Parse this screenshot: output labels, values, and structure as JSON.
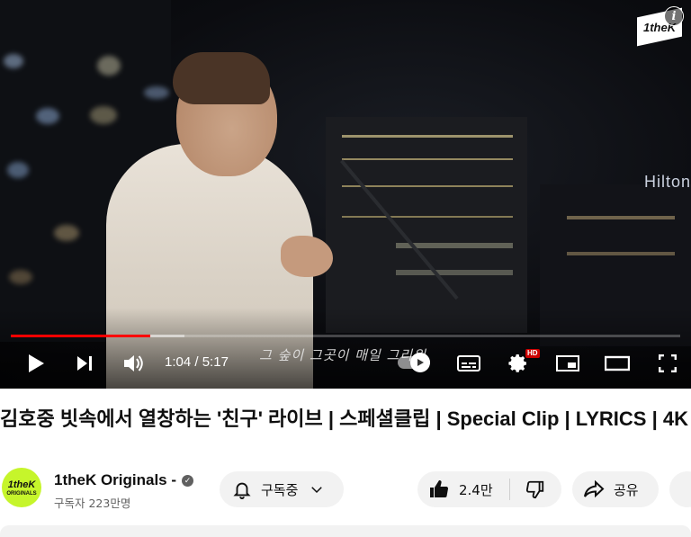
{
  "player": {
    "watermark": "1theK",
    "info_icon": "i",
    "building_sign": "Hilton",
    "subtitle": "그 숲이 그곳이 매일 그리워",
    "time_current": "1:04",
    "time_separator": "/",
    "time_total": "5:17",
    "progress_played_fraction": 0.208,
    "progress_buffered_fraction": 0.26,
    "hd_badge": "HD",
    "accent_color": "#ff0000"
  },
  "video": {
    "title": "김호중 빗속에서 열창하는 '친구' 라이브 | 스페셜클립 | Special Clip | LYRICS | 4K"
  },
  "channel": {
    "avatar_line1": "1theK",
    "avatar_line2": "ORIGINALS",
    "avatar_color": "#c6f52b",
    "name": "1theK Originals",
    "name_suffix": "-",
    "subscribers": "구독자 223만명"
  },
  "actions": {
    "subscribe_label": "구독중",
    "like_count": "2.4만",
    "share_label": "공유"
  }
}
